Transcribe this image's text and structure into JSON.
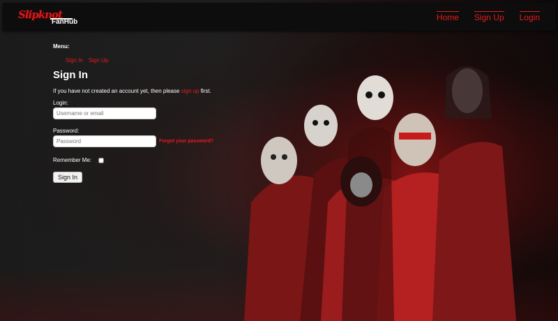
{
  "brand": {
    "logo_text": "Slipknot",
    "sub": "FanHub"
  },
  "nav": [
    "Home",
    "Sign Up",
    "Login"
  ],
  "menu": {
    "label": "Menu:",
    "items": [
      "Sign In",
      "Sign Up"
    ]
  },
  "form": {
    "title": "Sign In",
    "intro_before": "If you have not created an account yet, then please ",
    "intro_link": "sign up",
    "intro_after": " first.",
    "login_label": "Login:",
    "login_placeholder": "Username or email",
    "password_label": "Password:",
    "password_placeholder": "Password",
    "forgot_link": "Forgot your password?",
    "remember_label": "Remember Me:",
    "submit_label": "Sign In"
  },
  "colors": {
    "accent": "#e41b1b",
    "topbar": "#0d0d0d",
    "background": "#1a1a1a"
  }
}
